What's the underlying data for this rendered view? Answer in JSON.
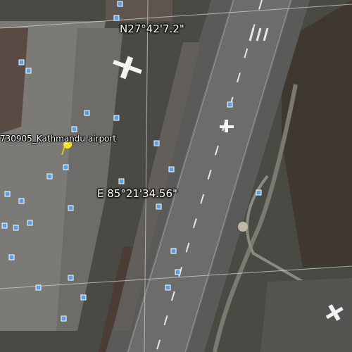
{
  "map": {
    "type": "satellite",
    "latitude_label": "N27°42'7.2\"",
    "longitude_label": "E 85°21'34.56\"",
    "placemark": {
      "label": "730905_Kathmandu airport",
      "icon": "yellow-pushpin-icon",
      "color": "#f2e41c"
    },
    "photo_marker_icon": "photo-marker-icon",
    "colors": {
      "grid_line": "#d0d0d0",
      "photo_marker": "#5aa0e6",
      "runway": "#5a5a58"
    }
  }
}
